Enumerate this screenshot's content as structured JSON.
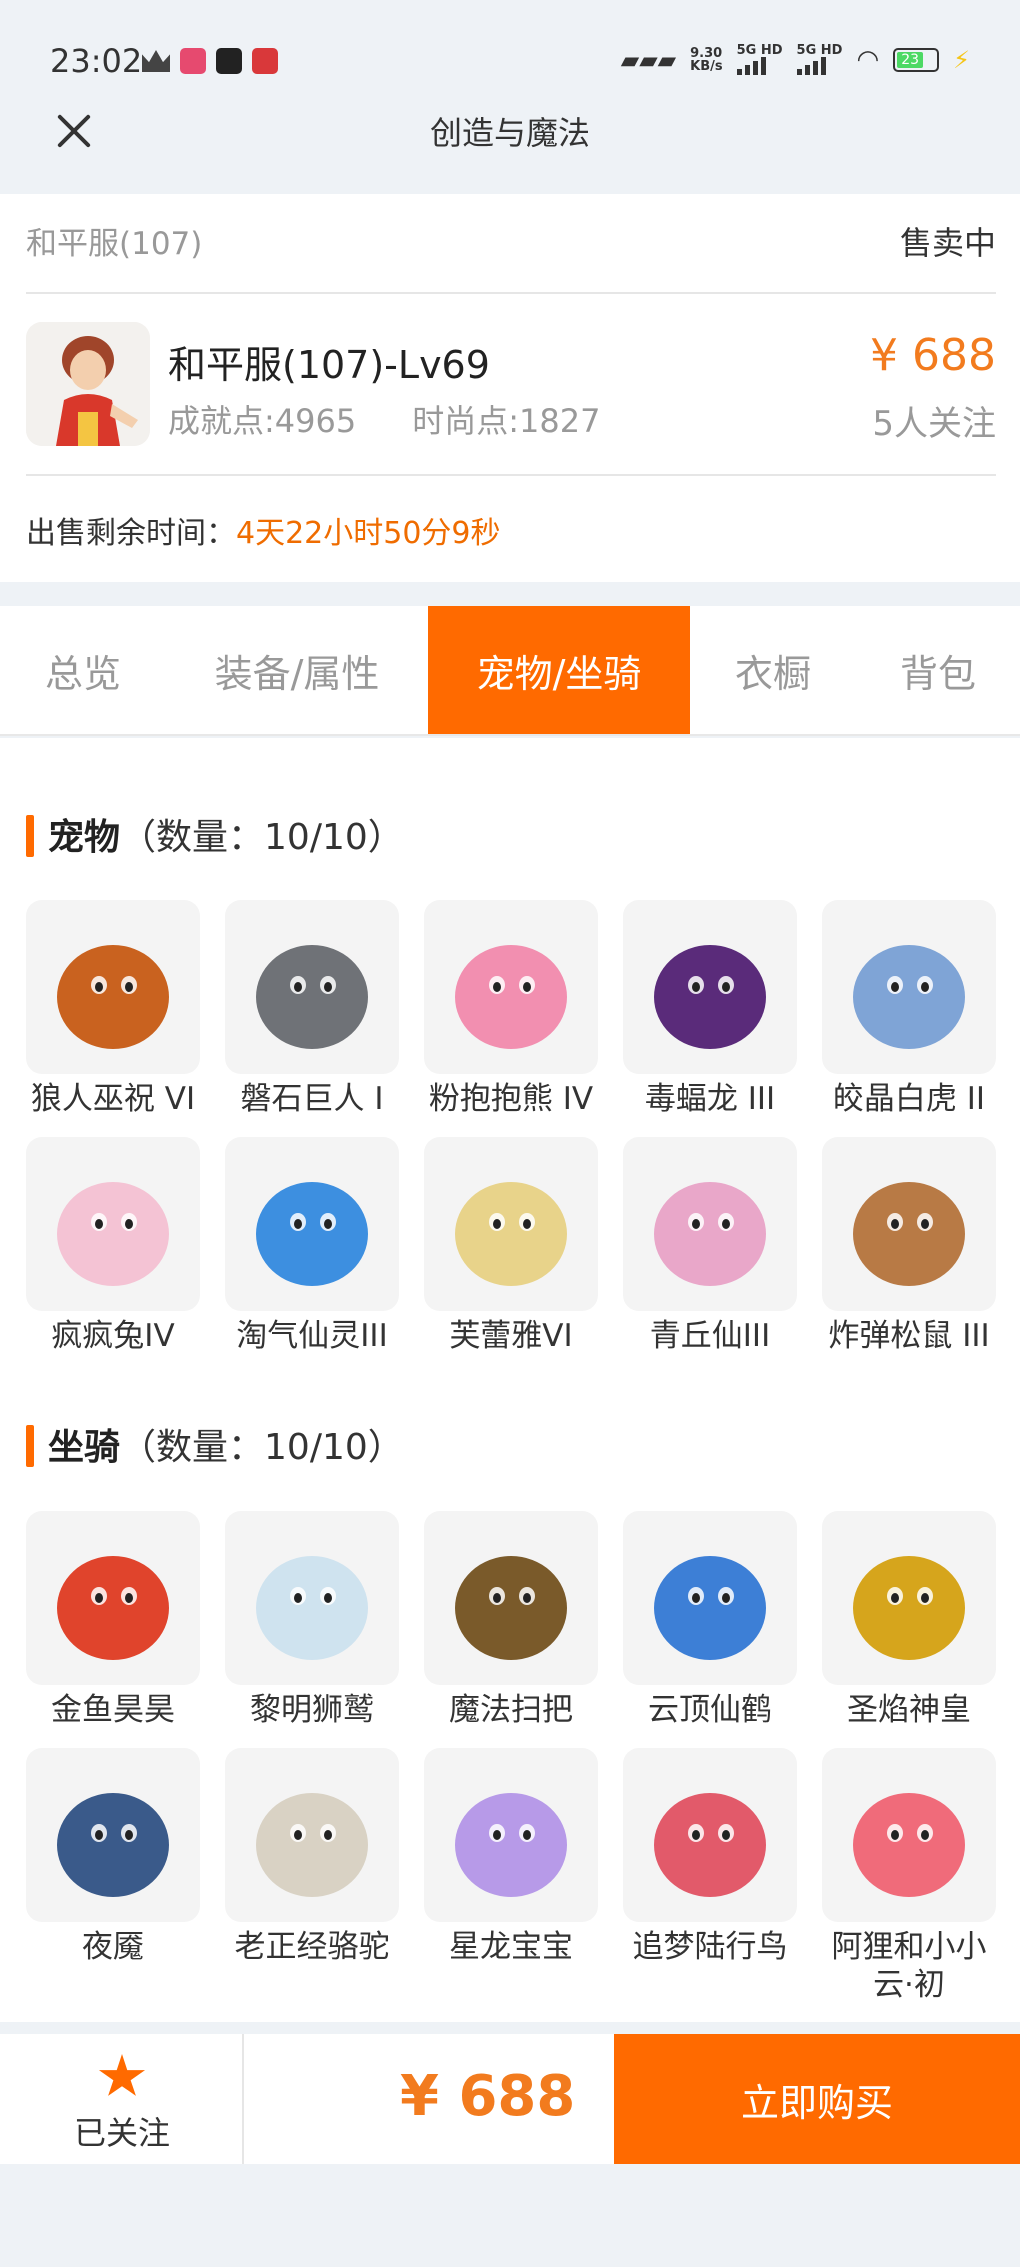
{
  "status_bar": {
    "time": "23:02",
    "net_speed_value": "9.30",
    "net_speed_unit": "KB/s",
    "signal_1": "5G HD",
    "signal_2": "5G HD",
    "battery": "23"
  },
  "nav": {
    "title": "创造与魔法"
  },
  "listing": {
    "server": "和平服(107)",
    "status": "售卖中",
    "character_title": "和平服(107)-Lv69",
    "achievement": "成就点:4965",
    "fashion": "时尚点:1827",
    "price": "¥ 688",
    "followers": "5人关注",
    "remaining_label": "出售剩余时间：",
    "remaining_time": "4天22小时50分9秒"
  },
  "tabs": [
    {
      "label": "总览"
    },
    {
      "label": "装备/属性"
    },
    {
      "label": "宠物/坐骑"
    },
    {
      "label": "衣橱"
    },
    {
      "label": "背包"
    }
  ],
  "pets": {
    "title": "宠物",
    "count": "（数量：10/10）",
    "items": [
      {
        "name": "狼人巫祝 VI",
        "color": "#c9621f"
      },
      {
        "name": "磐石巨人 I",
        "color": "#6f7277"
      },
      {
        "name": "粉抱抱熊 IV",
        "color": "#f28fb0"
      },
      {
        "name": "毒蝠龙 III",
        "color": "#5a2b7a"
      },
      {
        "name": "皎晶白虎 II",
        "color": "#7fa4d6"
      },
      {
        "name": "疯疯兔IV",
        "color": "#f4c3d4"
      },
      {
        "name": "淘气仙灵III",
        "color": "#3d8fe0"
      },
      {
        "name": "芙蕾雅VI",
        "color": "#e8d38a"
      },
      {
        "name": "青丘仙III",
        "color": "#e9a7c9"
      },
      {
        "name": "炸弹松鼠 III",
        "color": "#b87a45"
      }
    ]
  },
  "mounts": {
    "title": "坐骑",
    "count": "（数量：10/10）",
    "items": [
      {
        "name": "金鱼昊昊",
        "color": "#e0442c"
      },
      {
        "name": "黎明狮鹫",
        "color": "#cfe3ef"
      },
      {
        "name": "魔法扫把",
        "color": "#7a5a2a"
      },
      {
        "name": "云顶仙鹤",
        "color": "#3d7fd6"
      },
      {
        "name": "圣焰神皇",
        "color": "#d6a51c"
      },
      {
        "name": "夜魇",
        "color": "#3a5a8a"
      },
      {
        "name": "老正经骆驼",
        "color": "#d9d2c4"
      },
      {
        "name": "星龙宝宝",
        "color": "#b79ae8"
      },
      {
        "name": "追梦陆行鸟",
        "color": "#e25a6a"
      },
      {
        "name": "阿狸和小小云·初",
        "color": "#f06b7a"
      }
    ]
  },
  "bottom": {
    "follow_label": "已关注",
    "price": "¥ 688",
    "buy_label": "立即购买"
  },
  "colors": {
    "accent": "#ff6a00",
    "price": "#f27b1e"
  }
}
